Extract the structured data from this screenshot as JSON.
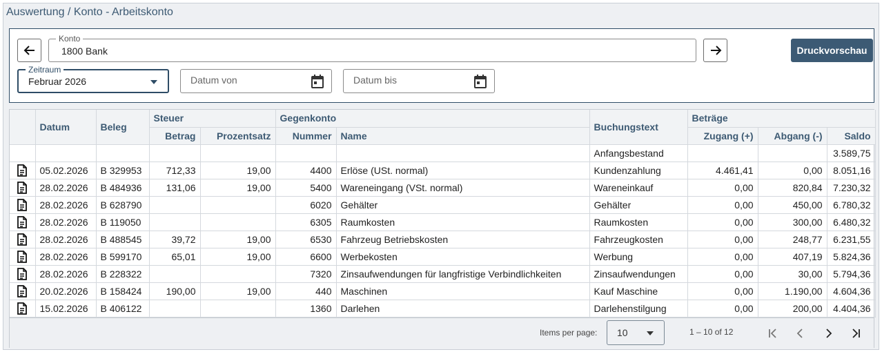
{
  "window": {
    "title": "Auswertung / Konto - Arbeitskonto"
  },
  "filters": {
    "konto_label": "Konto",
    "konto_value": "1800 Bank",
    "zeitraum_label": "Zeitraum",
    "zeitraum_value": "Februar 2026",
    "datum_von_placeholder": "Datum von",
    "datum_bis_placeholder": "Datum bis",
    "print_label": "Druckvorschau"
  },
  "table": {
    "group_headers": {
      "steuer": "Steuer",
      "gegenkonto": "Gegenkonto",
      "betraege": "Beträge"
    },
    "headers": {
      "datum": "Datum",
      "beleg": "Beleg",
      "betrag": "Betrag",
      "prozentsatz": "Prozentsatz",
      "nummer": "Nummer",
      "name": "Name",
      "buchungstext": "Buchungstext",
      "zugang": "Zugang (+)",
      "abgang": "Abgang (-)",
      "saldo": "Saldo"
    },
    "opening": {
      "label": "Anfangsbestand",
      "saldo": "3.589,75"
    },
    "rows": [
      {
        "datum": "05.02.2026",
        "beleg": "B 329953",
        "betrag": "712,33",
        "prozentsatz": "19,00",
        "nummer": "4400",
        "name": "Erlöse (USt. normal)",
        "buchungstext": "Kundenzahlung",
        "zugang": "4.461,41",
        "abgang": "0,00",
        "saldo": "8.051,16"
      },
      {
        "datum": "28.02.2026",
        "beleg": "B 484936",
        "betrag": "131,06",
        "prozentsatz": "19,00",
        "nummer": "5400",
        "name": "Wareneingang (VSt. normal)",
        "buchungstext": "Wareneinkauf",
        "zugang": "0,00",
        "abgang": "820,84",
        "saldo": "7.230,32"
      },
      {
        "datum": "28.02.2026",
        "beleg": "B 628790",
        "betrag": "",
        "prozentsatz": "",
        "nummer": "6020",
        "name": "Gehälter",
        "buchungstext": "Gehälter",
        "zugang": "0,00",
        "abgang": "450,00",
        "saldo": "6.780,32"
      },
      {
        "datum": "28.02.2026",
        "beleg": "B 119050",
        "betrag": "",
        "prozentsatz": "",
        "nummer": "6305",
        "name": "Raumkosten",
        "buchungstext": "Raumkosten",
        "zugang": "0,00",
        "abgang": "300,00",
        "saldo": "6.480,32"
      },
      {
        "datum": "28.02.2026",
        "beleg": "B 488545",
        "betrag": "39,72",
        "prozentsatz": "19,00",
        "nummer": "6530",
        "name": "Fahrzeug Betriebskosten",
        "buchungstext": "Fahrzeugkosten",
        "zugang": "0,00",
        "abgang": "248,77",
        "saldo": "6.231,55"
      },
      {
        "datum": "28.02.2026",
        "beleg": "B 599170",
        "betrag": "65,01",
        "prozentsatz": "19,00",
        "nummer": "6600",
        "name": "Werbekosten",
        "buchungstext": "Werbung",
        "zugang": "0,00",
        "abgang": "407,19",
        "saldo": "5.824,36"
      },
      {
        "datum": "28.02.2026",
        "beleg": "B 228322",
        "betrag": "",
        "prozentsatz": "",
        "nummer": "7320",
        "name": "Zinsaufwendungen für langfristige Verbindlichkeiten",
        "buchungstext": "Zinsaufwendungen",
        "zugang": "0,00",
        "abgang": "30,00",
        "saldo": "5.794,36"
      },
      {
        "datum": "20.02.2026",
        "beleg": "B 158424",
        "betrag": "190,00",
        "prozentsatz": "19,00",
        "nummer": "440",
        "name": "Maschinen",
        "buchungstext": "Kauf Maschine",
        "zugang": "0,00",
        "abgang": "1.190,00",
        "saldo": "4.604,36"
      },
      {
        "datum": "15.02.2026",
        "beleg": "B 406122",
        "betrag": "",
        "prozentsatz": "",
        "nummer": "1360",
        "name": "Darlehen",
        "buchungstext": "Darlehenstilgung",
        "zugang": "0,00",
        "abgang": "200,00",
        "saldo": "4.404,36"
      }
    ],
    "row_icon": "document-icon"
  },
  "paginator": {
    "items_per_page_label": "Items per page:",
    "items_per_page_value": "10",
    "range_label": "1 – 10 of 12"
  },
  "colors": {
    "accent": "#3c5a74",
    "header_text": "#3d5a73",
    "panel_bg": "#eef0f3"
  }
}
